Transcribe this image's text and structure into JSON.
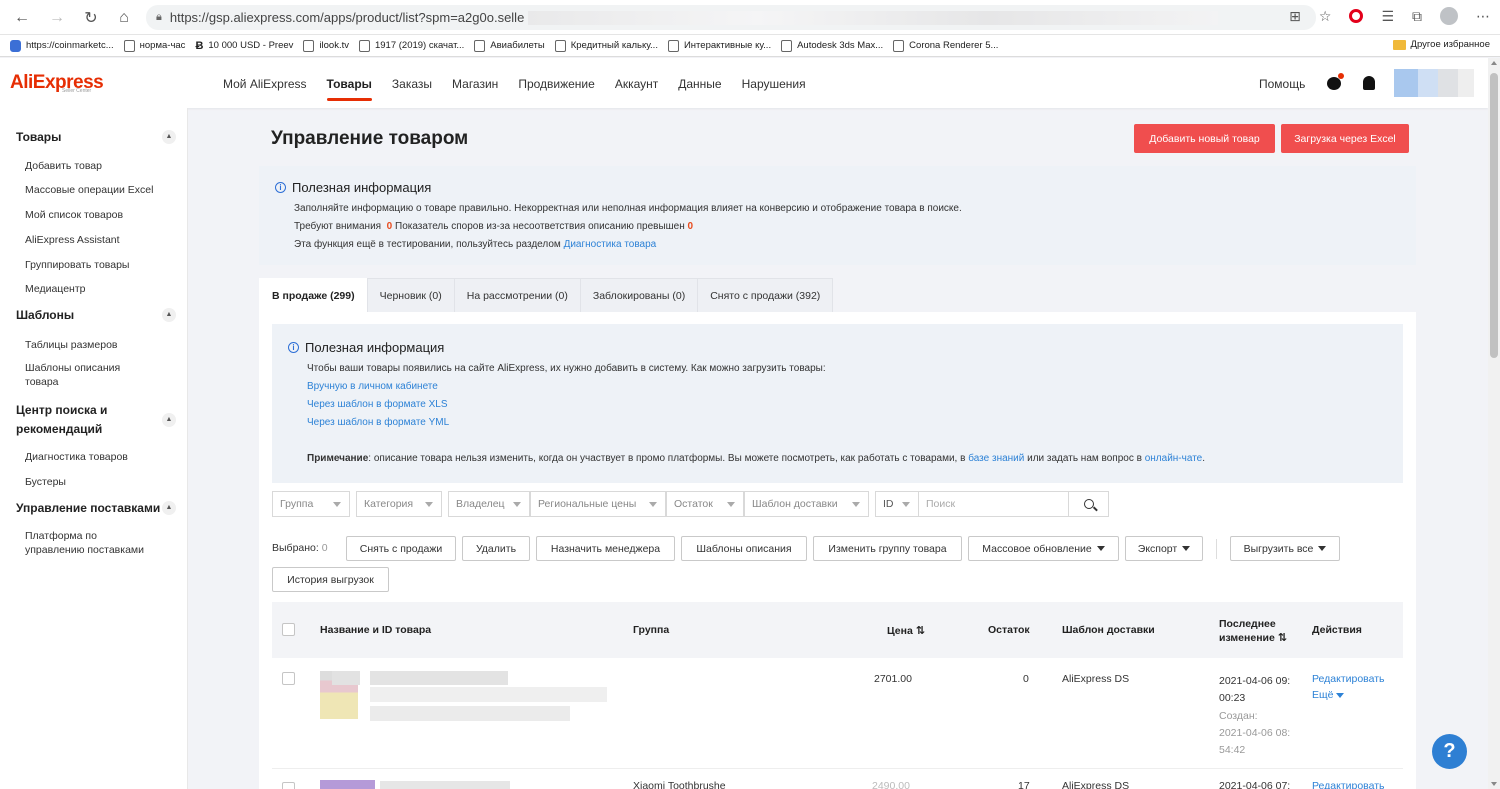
{
  "browser": {
    "url": "https://gsp.aliexpress.com/apps/product/list?spm=a2g0o.selle",
    "bookmarks": [
      "https://coinmarketc...",
      "норма-час",
      "10 000 USD - Preev",
      "ilook.tv",
      "1917 (2019) скачат...",
      "Авиабилеты",
      "Кредитный кальку...",
      "Интерактивные ку...",
      "Autodesk 3ds Max...",
      "Corona Renderer 5..."
    ],
    "other_bookmarks": "Другое избранное"
  },
  "header": {
    "logo": "AliExpress",
    "logo_sub": "Seller Center",
    "nav": [
      "Мой AliExpress",
      "Товары",
      "Заказы",
      "Магазин",
      "Продвижение",
      "Аккаунт",
      "Данные",
      "Нарушения"
    ],
    "active_nav": "Товары",
    "help": "Помощь"
  },
  "sidebar": {
    "sections": [
      {
        "title": "Товары",
        "items": [
          "Добавить товар",
          "Массовые операции Excel",
          "Мой список товаров",
          "AliExpress Assistant",
          "Группировать товары",
          "Медиацентр"
        ]
      },
      {
        "title": "Шаблоны",
        "items": [
          "Таблицы размеров",
          "Шаблоны описания товара"
        ]
      },
      {
        "title": "Центр поиска и рекомендаций",
        "items": [
          "Диагностика товаров",
          "Бустеры"
        ]
      },
      {
        "title": "Управление поставками",
        "items": [
          "Платформа по управлению поставками"
        ]
      }
    ]
  },
  "page": {
    "title": "Управление товаром",
    "add_button": "Добавить новый товар",
    "excel_button": "Загрузка через Excel"
  },
  "info1": {
    "title": "Полезная информация",
    "line1": "Заполняйте информацию о товаре правильно. Некорректная или неполная информация влияет на конверсию и отображение товара в поиске.",
    "attention_label": "Требуют внимания",
    "attention_count": "0",
    "disputes_label": "Показатель споров из-за несоответствия описанию превышен",
    "disputes_count": "0",
    "line3_prefix": "Эта функция ещё в тестировании, пользуйтесь разделом",
    "line3_link": "Диагностика товара"
  },
  "tabs": [
    "В продаже (299)",
    "Черновик (0)",
    "На рассмотрении (0)",
    "Заблокированы (0)",
    "Снято с продажи (392)"
  ],
  "info2": {
    "title": "Полезная информация",
    "intro": "Чтобы ваши товары появились на сайте AliExpress, их нужно добавить в систему. Как можно загрузить товары:",
    "links": [
      "Вручную в личном кабинете",
      "Через шаблон в формате XLS",
      "Через шаблон в формате YML"
    ],
    "note_label": "Примечание",
    "note_text": ": описание товара нельзя изменить, когда он участвует в промо платформы. Вы можете посмотреть, как работать с товарами, в",
    "note_link1": "базе знаний",
    "note_mid": "или задать нам вопрос в",
    "note_link2": "онлайн-чате",
    "note_end": "."
  },
  "filters": {
    "group": "Группа",
    "category": "Категория",
    "owner": "Владелец",
    "regional": "Региональные цены",
    "stock": "Остаток",
    "shipping": "Шаблон доставки",
    "id": "ID",
    "search_placeholder": "Поиск"
  },
  "actions": {
    "selected_label": "Выбрано:",
    "selected_count": "0",
    "buttons": [
      "Снять с продажи",
      "Удалить",
      "Назначить менеджера",
      "Шаблоны описания",
      "Изменить группу товара",
      "Массовое обновление",
      "Экспорт",
      "Выгрузить все",
      "История выгрузок"
    ]
  },
  "table": {
    "columns": {
      "name": "Название и ID товара",
      "group": "Группа",
      "price": "Цена",
      "stock": "Остаток",
      "shipping": "Шаблон доставки",
      "updated_1": "Последнее",
      "updated_2": "изменение",
      "actions": "Действия"
    },
    "rows": [
      {
        "group": "",
        "price": "2701.00",
        "stock": "0",
        "shipping": "AliExpress DS",
        "updated_1": "2021-04-06 09:",
        "updated_2": "00:23",
        "created_label": "Создан:",
        "created_1": "2021-04-06 08:",
        "created_2": "54:42",
        "edit": "Редактировать",
        "more": "Ещё"
      },
      {
        "group": "Xiaomi Toothbrushe",
        "price": "2490.00",
        "stock": "17",
        "shipping": "AliExpress DS",
        "updated_1": "2021-04-06 07:",
        "edit": "Редактировать"
      }
    ]
  },
  "help_fab": "?"
}
